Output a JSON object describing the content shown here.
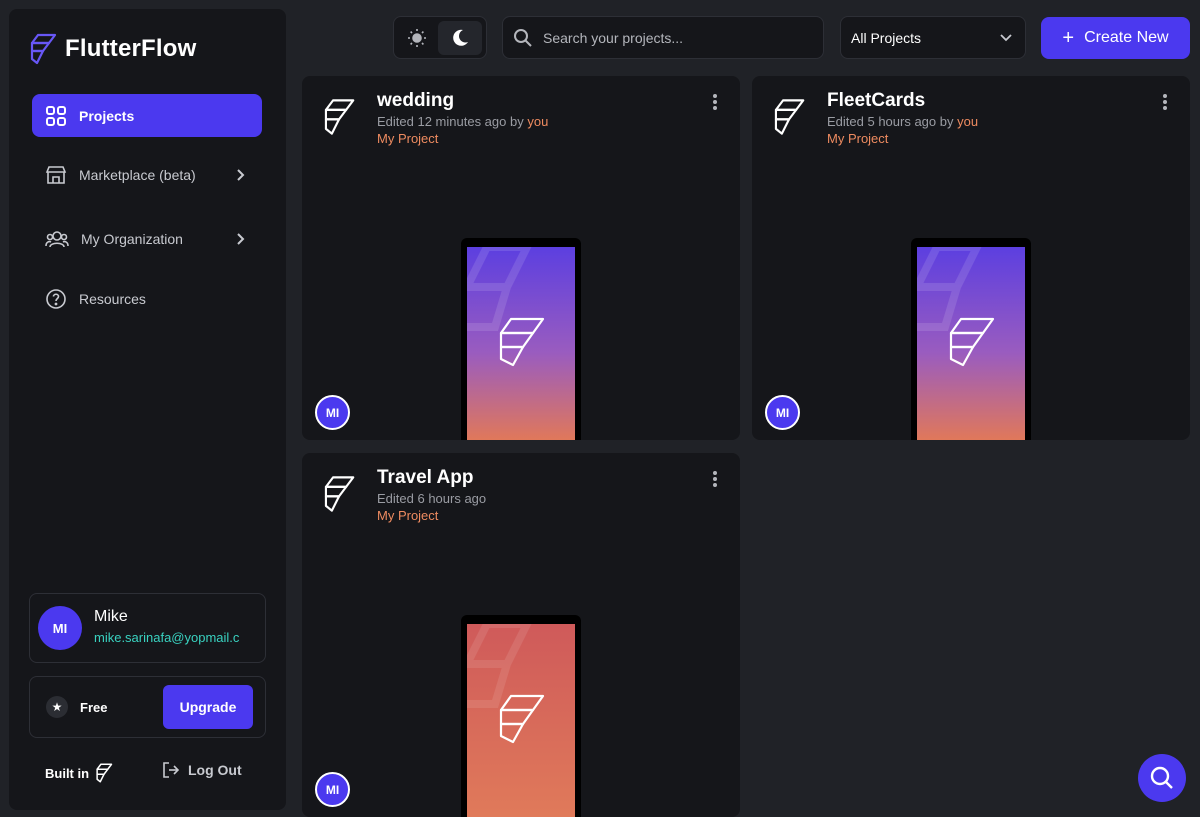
{
  "brand": {
    "name": "FlutterFlow",
    "icon": "flutterflow-logo-icon"
  },
  "sidebar": {
    "items": [
      {
        "label": "Projects",
        "icon": "grid-icon",
        "active": true
      },
      {
        "label": "Marketplace (beta)",
        "icon": "store-icon",
        "has_submenu": true
      },
      {
        "label": "My Organization",
        "icon": "people-icon",
        "has_submenu": true
      },
      {
        "label": "Resources",
        "icon": "help-circle-icon"
      }
    ],
    "user": {
      "initials": "MI",
      "name": "Mike",
      "email": "mike.sarinafa@yopmail.c"
    },
    "plan": {
      "label": "Free",
      "upgrade_label": "Upgrade"
    },
    "built_in_label": "Built in",
    "logout_label": "Log Out"
  },
  "toolbar": {
    "theme": {
      "light_icon": "sun-icon",
      "dark_icon": "moon-icon",
      "selected": "dark"
    },
    "search": {
      "placeholder": "Search your projects...",
      "value": ""
    },
    "filter": {
      "selected": "All Projects"
    },
    "create_label": "Create New"
  },
  "projects": [
    {
      "title": "wedding",
      "edited": "Edited 12 minutes ago",
      "by_prefix": " by ",
      "by_user": "you",
      "tag": "My Project",
      "owner_initials": "MI",
      "preview": "purple-gradient"
    },
    {
      "title": "FleetCards",
      "edited": "Edited 5 hours ago",
      "by_prefix": " by ",
      "by_user": "you",
      "tag": "My Project",
      "owner_initials": "MI",
      "preview": "purple-gradient"
    },
    {
      "title": "Travel App",
      "edited": "Edited 6 hours ago",
      "by_prefix": "",
      "by_user": "",
      "tag": "My Project",
      "owner_initials": "MI",
      "preview": "coral-gradient"
    }
  ],
  "colors": {
    "accent": "#4b39ef",
    "orange": "#ee8b60",
    "teal": "#39d2c0",
    "panel": "#15161a",
    "bg": "#202227"
  }
}
